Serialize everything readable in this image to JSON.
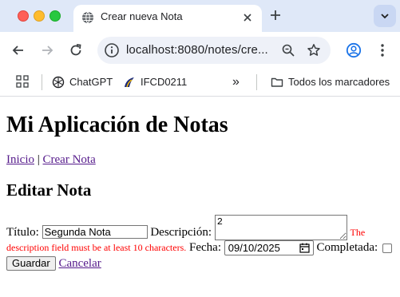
{
  "browser": {
    "tab_title": "Crear nueva Nota",
    "url": "localhost:8080/notes/cre...",
    "bookmarks": [
      {
        "label": "ChatGPT"
      },
      {
        "label": "IFCD0211"
      }
    ],
    "overflow_label": "»",
    "all_bookmarks_label": "Todos los marcadores"
  },
  "page": {
    "title": "Mi Aplicación de Notas",
    "nav": {
      "home": "Inicio",
      "separator": " | ",
      "create": "Crear Nota"
    },
    "heading": "Editar Nota",
    "form": {
      "title_label": "Título:",
      "title_value": "Segunda Nota",
      "description_label": "Descripción:",
      "description_value": "2",
      "description_error": "The description field must be at least 10 characters.",
      "date_label": "Fecha:",
      "date_value": "09/10/2025",
      "completed_label": "Completada:",
      "completed_checked": false,
      "save_label": "Guardar",
      "cancel_label": "Cancelar"
    }
  }
}
